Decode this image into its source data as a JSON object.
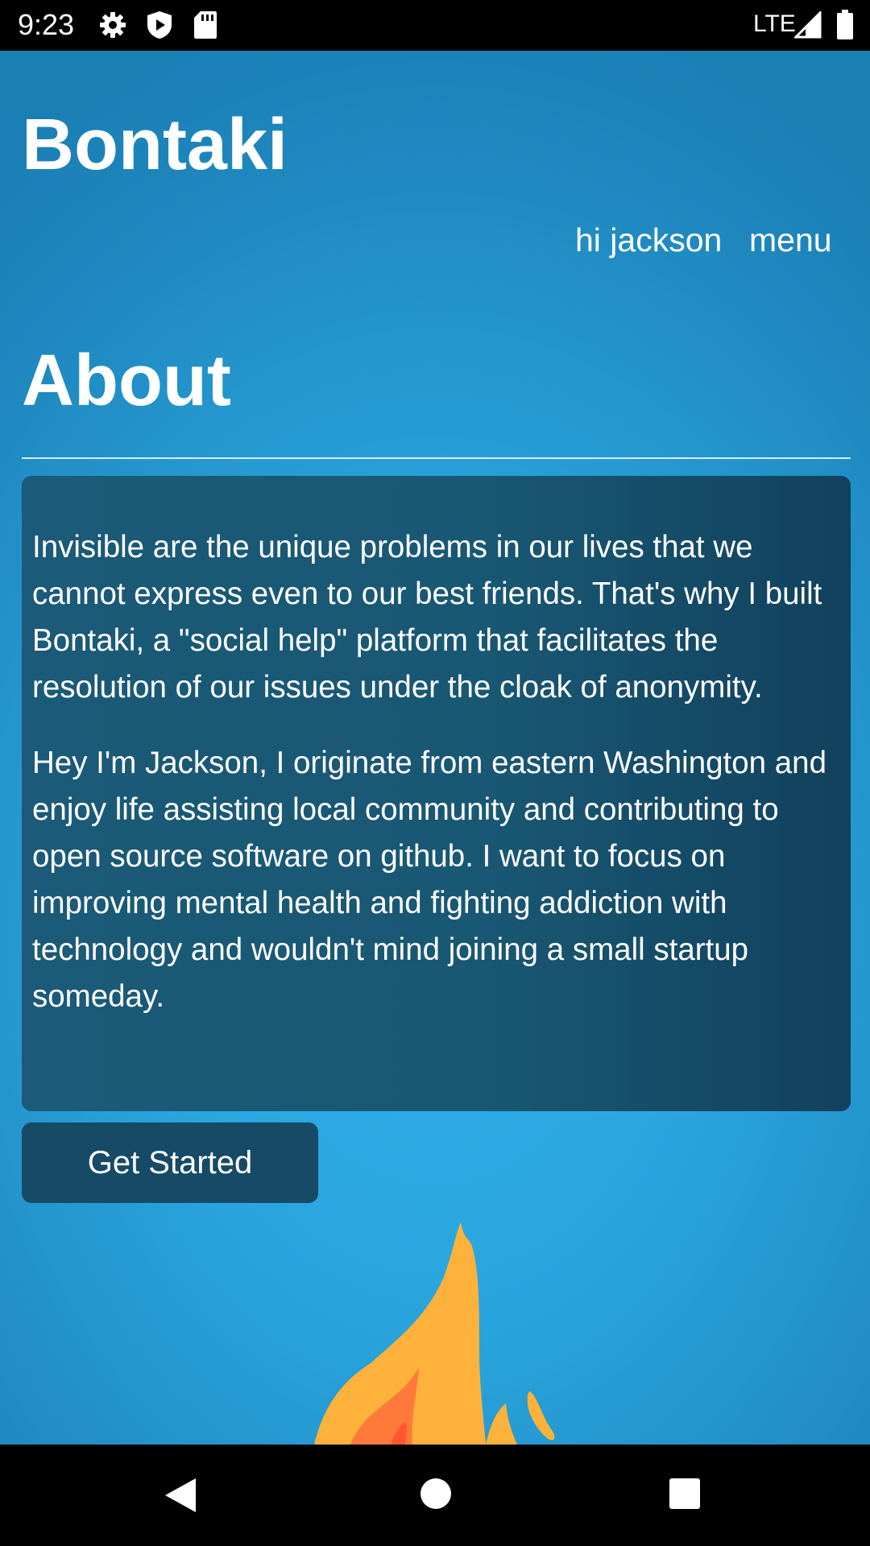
{
  "status_bar": {
    "time": "9:23",
    "network": "LTE",
    "icons": [
      "gear-icon",
      "shield-play-icon",
      "sd-card-icon",
      "signal-icon",
      "battery-icon"
    ]
  },
  "app": {
    "brand": "Bontaki",
    "greeting": "hi jackson",
    "menu_label": "menu",
    "page_title": "About",
    "paragraphs": [
      "Invisible are the unique problems in our lives that we cannot express even to our best friends. That's why I built Bontaki, a \"social help\" platform that facilitates the resolution of our issues under the cloak of anonymity.",
      "Hey I'm Jackson, I originate from eastern Washington and enjoy life assisting local community and contributing to open source software on github. I want to focus on improving mental health and fighting addiction with technology and wouldn't mind joining a small startup someday."
    ],
    "cta_label": "Get Started",
    "decoration": "flame-illustration"
  },
  "nav_bar": {
    "buttons": [
      "back-icon",
      "home-icon",
      "recents-icon"
    ]
  },
  "colors": {
    "background": "#2aa4dd",
    "card": "#1b5a78",
    "button": "#164a66",
    "text": "#ffffff"
  }
}
